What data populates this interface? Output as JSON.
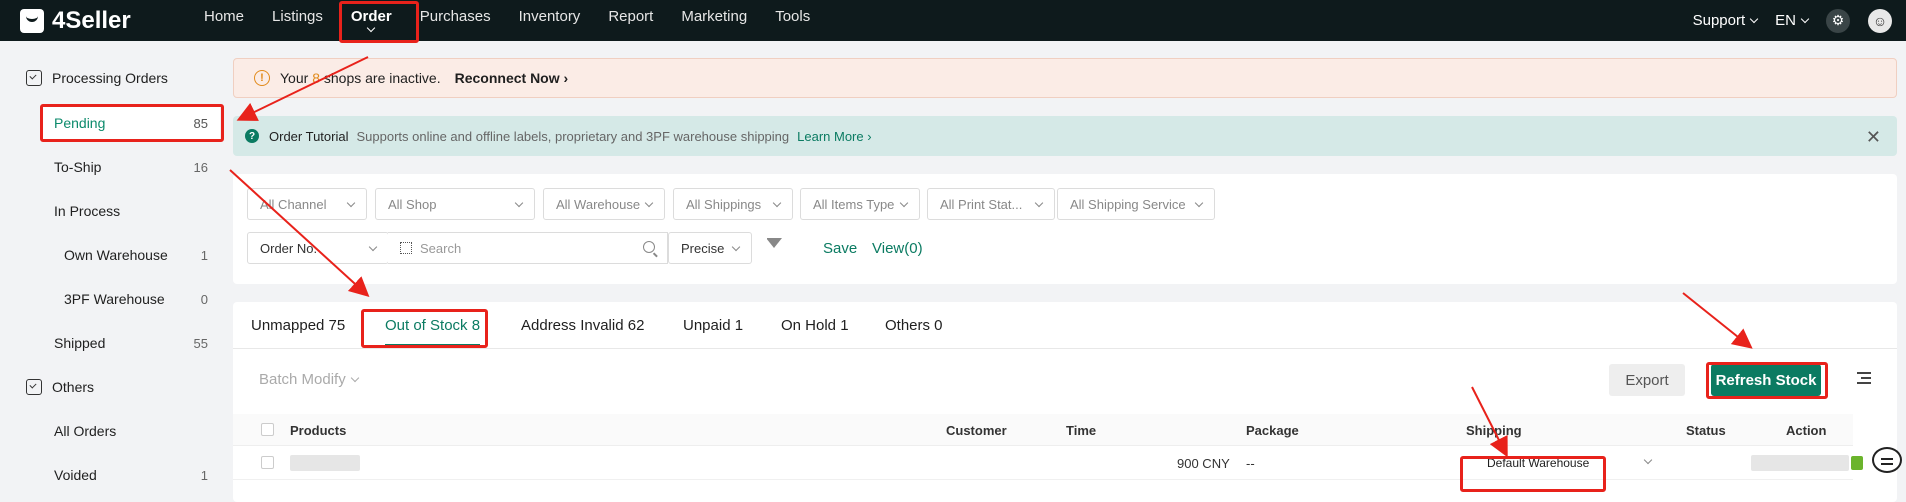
{
  "app": {
    "name": "4Seller"
  },
  "nav": {
    "items": [
      "Home",
      "Listings",
      "Order",
      "Purchases",
      "Inventory",
      "Report",
      "Marketing",
      "Tools"
    ],
    "active": "Order",
    "support": "Support",
    "language": "EN"
  },
  "sidebar": {
    "groups": [
      {
        "label": "Processing Orders",
        "icon": "clipboard-icon"
      },
      {
        "label": "Others",
        "icon": "clipboard-icon"
      }
    ],
    "items": [
      {
        "label": "Pending",
        "count": "85"
      },
      {
        "label": "To-Ship",
        "count": "16"
      },
      {
        "label": "In Process",
        "count": ""
      },
      {
        "label": "Own Warehouse",
        "count": "1"
      },
      {
        "label": "3PF Warehouse",
        "count": "0"
      },
      {
        "label": "Shipped",
        "count": "55"
      },
      {
        "label": "All Orders",
        "count": ""
      },
      {
        "label": "Voided",
        "count": "1"
      }
    ]
  },
  "warning": {
    "prefix": "Your",
    "number": "8",
    "suffix": "shops are inactive.",
    "action": "Reconnect Now"
  },
  "tutorial": {
    "title": "Order Tutorial",
    "description": "Supports online and offline labels, proprietary and 3PF warehouse shipping",
    "link": "Learn More"
  },
  "filters": {
    "row1": [
      "All Channel",
      "All Shop",
      "All Warehouse",
      "All Shippings",
      "All Items Type",
      "All Print Stat...",
      "All Shipping Service"
    ],
    "search_field": "Order No.",
    "search_placeholder": "Search",
    "match_mode": "Precise",
    "save": "Save",
    "view": "View(0)"
  },
  "tabs": [
    "Unmapped 75",
    "Out of Stock 8",
    "Address Invalid 62",
    "Unpaid 1",
    "On Hold 1",
    "Others 0"
  ],
  "active_tab": "Out of Stock 8",
  "toolbar": {
    "batch_modify": "Batch Modify",
    "export": "Export",
    "refresh_stock": "Refresh Stock"
  },
  "table": {
    "headers": [
      "Products",
      "Customer",
      "Time",
      "Package",
      "Shipping",
      "Status",
      "Action"
    ],
    "rows": [
      {
        "amount": "900 CNY",
        "package": "--",
        "shipping": "Default Warehouse"
      }
    ]
  },
  "colors": {
    "accent": "#0b7b62",
    "topbar": "#0e1a1c",
    "warning": "#e28a1a",
    "annotation": "#e8221b"
  }
}
